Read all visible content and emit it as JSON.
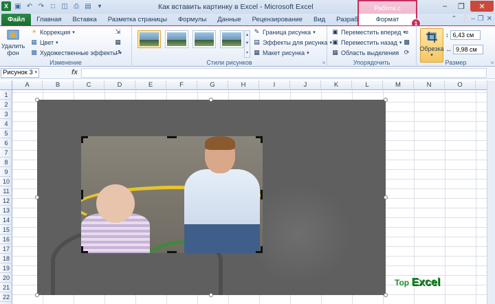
{
  "window": {
    "title": "Как вставить картинку в Excel  -  Microsoft Excel",
    "context_tab_header": "Работа с рисунками"
  },
  "tabs": [
    "Файл",
    "Главная",
    "Вставка",
    "Разметка страницы",
    "Формулы",
    "Данные",
    "Рецензирование",
    "Вид",
    "Разработчик"
  ],
  "context_tab": "Формат",
  "callout_number": "1",
  "ribbon": {
    "remove_bg": "Удалить фон",
    "adjust": {
      "corrections": "Коррекция",
      "color": "Цвет",
      "artistic": "Художественные эффекты",
      "label": "Изменение"
    },
    "styles": {
      "border": "Граница рисунка",
      "effects": "Эффекты для рисунка",
      "layout": "Макет рисунка",
      "label": "Стили рисунков"
    },
    "arrange": {
      "forward": "Переместить вперед",
      "backward": "Переместить назад",
      "selection": "Область выделения",
      "label": "Упорядочить"
    },
    "size": {
      "crop": "Обрезка",
      "height": "6,43 см",
      "width": "9,98 см",
      "label": "Размер"
    }
  },
  "formula_bar": {
    "name_box": "Рисунок 3",
    "fx": "fx",
    "formula": ""
  },
  "columns": [
    "A",
    "B",
    "C",
    "D",
    "E",
    "F",
    "G",
    "H",
    "I",
    "J",
    "K",
    "L",
    "M",
    "N",
    "O"
  ],
  "rows": [
    "1",
    "2",
    "3",
    "4",
    "5",
    "6",
    "7",
    "8",
    "9",
    "10",
    "11",
    "12",
    "13",
    "14",
    "15",
    "16",
    "17",
    "18",
    "19",
    "20",
    "21",
    "22"
  ],
  "watermark": {
    "top": "Top",
    "excel": "Excel"
  },
  "colors": {
    "accent_context": "#c42f5d",
    "file_tab": "#1f7a3a"
  }
}
